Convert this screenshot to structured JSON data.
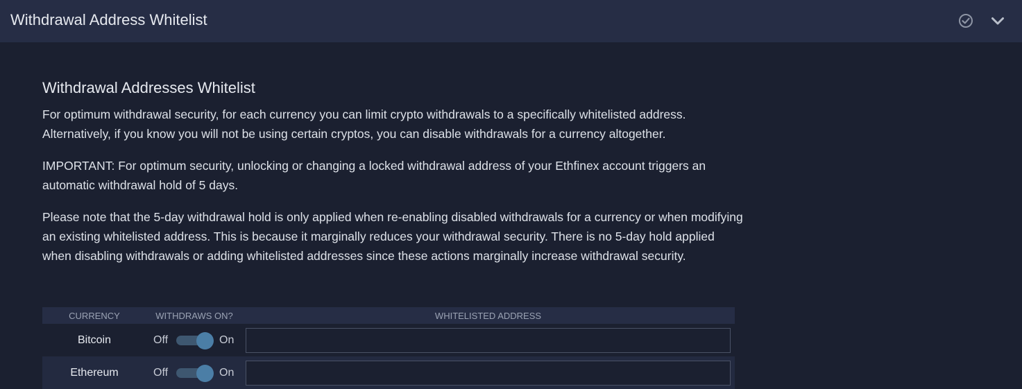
{
  "header": {
    "title": "Withdrawal Address Whitelist",
    "icons": [
      "check-circle-icon",
      "chevron-down-icon"
    ]
  },
  "section": {
    "title": "Withdrawal Addresses Whitelist",
    "para1": "For optimum withdrawal security, for each currency you can limit crypto withdrawals to a specifically whitelisted address. Alternatively, if you know you will not be using certain cryptos, you can disable withdrawals for a currency altogether.",
    "para2": "IMPORTANT: For optimum security, unlocking or changing a locked withdrawal address of your Ethfinex account triggers an automatic withdrawal hold of 5 days.",
    "para3": "Please note that the 5-day withdrawal hold is only applied when re-enabling disabled withdrawals for a currency or when modifying an existing whitelisted address. This is because it marginally reduces your withdrawal security. There is no 5-day hold applied when disabling withdrawals or adding whitelisted addresses since these actions marginally increase withdrawal security."
  },
  "table": {
    "headers": {
      "currency": "CURRENCY",
      "withdraws_on": "WITHDRAWS ON?",
      "address": "WHITELISTED ADDRESS"
    },
    "rows": [
      {
        "currency": "Bitcoin",
        "off_label": "Off",
        "on_label": "On",
        "toggle_state": "on",
        "address": ""
      },
      {
        "currency": "Ethereum",
        "off_label": "Off",
        "on_label": "On",
        "toggle_state": "on",
        "address": ""
      }
    ]
  },
  "colors": {
    "background": "#1b2030",
    "header_bg": "#262d45",
    "toggle_knob": "#4b7ea6",
    "toggle_track": "#3e5770"
  }
}
